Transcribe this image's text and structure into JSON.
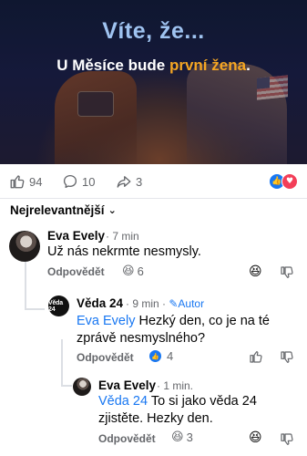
{
  "hero": {
    "title": "Víte, že...",
    "sub_prefix": "U Měsíce bude",
    "sub_highlight": "první žena",
    "sub_suffix": "."
  },
  "post_actions": {
    "like_count": "94",
    "comment_count": "10",
    "share_count": "3"
  },
  "sort_label": "Nejrelevantnější",
  "comments": [
    {
      "author": "Eva Evely",
      "time": "· 7 min",
      "text": "Už nás nekrmte nesmysly.",
      "reply_label": "Odpovědět",
      "reaction_emoji": "😆",
      "reaction_count": "6"
    },
    {
      "author": "Věda 24",
      "avatar_label": "Věda 24",
      "time": "· 9 min ·",
      "badge": "Autor",
      "mention": "Eva Evely",
      "text": "Hezký den, co je na té zprávě nesmyslného?",
      "reply_label": "Odpovědět",
      "reaction_count": "4"
    },
    {
      "author": "Eva Evely",
      "time": "· 1 min.",
      "mention": "Věda 24",
      "text": "To si jako věda 24 zjistěte. Hezky den.",
      "reply_label": "Odpovědět",
      "reaction_emoji": "😆",
      "reaction_count": "3"
    }
  ]
}
